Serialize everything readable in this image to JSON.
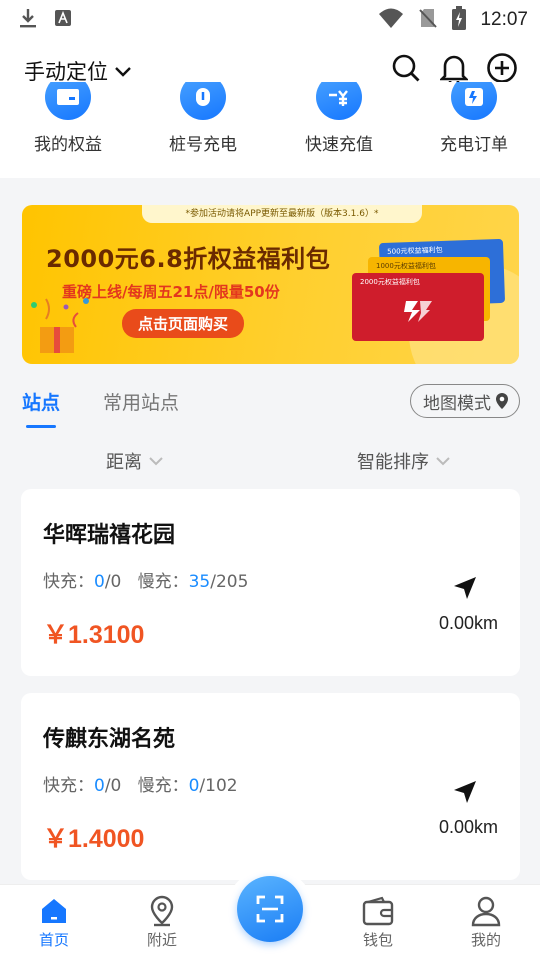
{
  "status_bar": {
    "time": "12:07"
  },
  "header": {
    "location_label": "手动定位"
  },
  "quick_actions": [
    {
      "label": "我的权益",
      "icon": "card-icon"
    },
    {
      "label": "桩号充电",
      "icon": "charger-pile-icon"
    },
    {
      "label": "快速充值",
      "icon": "recharge-icon"
    },
    {
      "label": "充电订单",
      "icon": "order-icon"
    }
  ],
  "banner": {
    "notice": "*参加活动请将APP更新至最新版（版本3.1.6）*",
    "title": "2000元6.8折权益福利包",
    "subtitle": "重磅上线/每周五21点/限量50份",
    "button_label": "点击页面购买",
    "card_labels": [
      "500元权益福利包",
      "1000元权益福利包",
      "2000元权益福利包"
    ]
  },
  "tabs": {
    "stations": "站点",
    "favorites": "常用站点",
    "map_mode": "地图模式"
  },
  "filters": {
    "distance": "距离",
    "sort": "智能排序"
  },
  "stations": [
    {
      "name": "华晖瑞禧花园",
      "fast_label": "快充：",
      "fast_avail": "0",
      "fast_total": "/0",
      "slow_label": "慢充：",
      "slow_avail": "35",
      "slow_total": "/205",
      "price": "￥1.3100",
      "distance": "0.00km"
    },
    {
      "name": "传麒东湖名苑",
      "fast_label": "快充：",
      "fast_avail": "0",
      "fast_total": "/0",
      "slow_label": "慢充：",
      "slow_avail": "0",
      "slow_total": "/102",
      "price": "￥1.4000",
      "distance": "0.00km"
    }
  ],
  "bottom_nav": {
    "home": "首页",
    "nearby": "附近",
    "wallet": "钱包",
    "mine": "我的"
  },
  "colors": {
    "accent": "#1677ff",
    "price": "#f05523",
    "available": "#1a8cff"
  }
}
